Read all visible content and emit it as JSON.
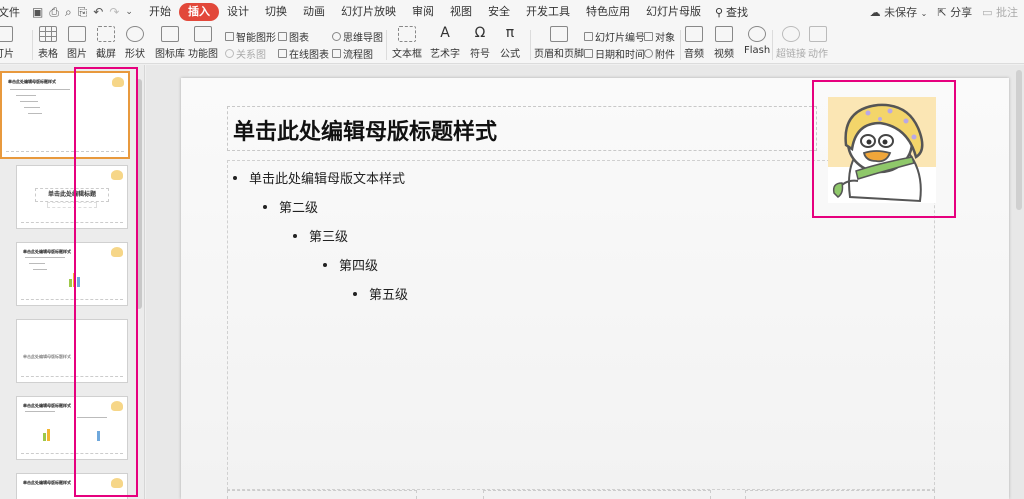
{
  "menubar": {
    "file_label": "文件",
    "tabs": [
      {
        "label": "开始",
        "active": false
      },
      {
        "label": "插入",
        "active": true
      },
      {
        "label": "设计",
        "active": false
      },
      {
        "label": "切换",
        "active": false
      },
      {
        "label": "动画",
        "active": false
      },
      {
        "label": "幻灯片放映",
        "active": false
      },
      {
        "label": "审阅",
        "active": false
      },
      {
        "label": "视图",
        "active": false
      },
      {
        "label": "安全",
        "active": false
      },
      {
        "label": "开发工具",
        "active": false
      },
      {
        "label": "特色应用",
        "active": false
      },
      {
        "label": "幻灯片母版",
        "active": false
      }
    ],
    "search_label": "查找",
    "unsaved_label": "未保存",
    "share_label": "分享",
    "comment_label": "批注",
    "accent_color": "#e2483a"
  },
  "ribbon": {
    "new_slide": "灯片",
    "table": "表格",
    "picture": "图片",
    "screenshot": "截屏",
    "shape": "形状",
    "icon_lib": "图标库",
    "func_chart": "功能图",
    "smart_graphic": "智能图形",
    "chart": "图表",
    "mindmap": "思维导图",
    "relation": "关系图",
    "online_chart": "在线图表",
    "flowchart": "流程图",
    "textbox": "文本框",
    "wordart": "艺术字",
    "symbol": "符号",
    "formula": "公式",
    "header_footer": "页眉和页脚",
    "slide_number": "幻灯片编号",
    "object": "对象",
    "datetime": "日期和时间",
    "attachment": "附件",
    "audio": "音频",
    "video": "视频",
    "flash": "Flash",
    "hyperlink": "超链接",
    "action": "动作"
  },
  "thumbs": {
    "t2_title": "单击此处编辑标题",
    "t4_title": "单击此处编辑母版标题样式"
  },
  "slide": {
    "title": "单击此处编辑母版标题样式",
    "levels": [
      "单击此处编辑母版文本样式",
      "第二级",
      "第三级",
      "第四级",
      "第五级"
    ]
  },
  "colors": {
    "highlight": "#e6007e",
    "selected_thumb": "#e8993d"
  }
}
